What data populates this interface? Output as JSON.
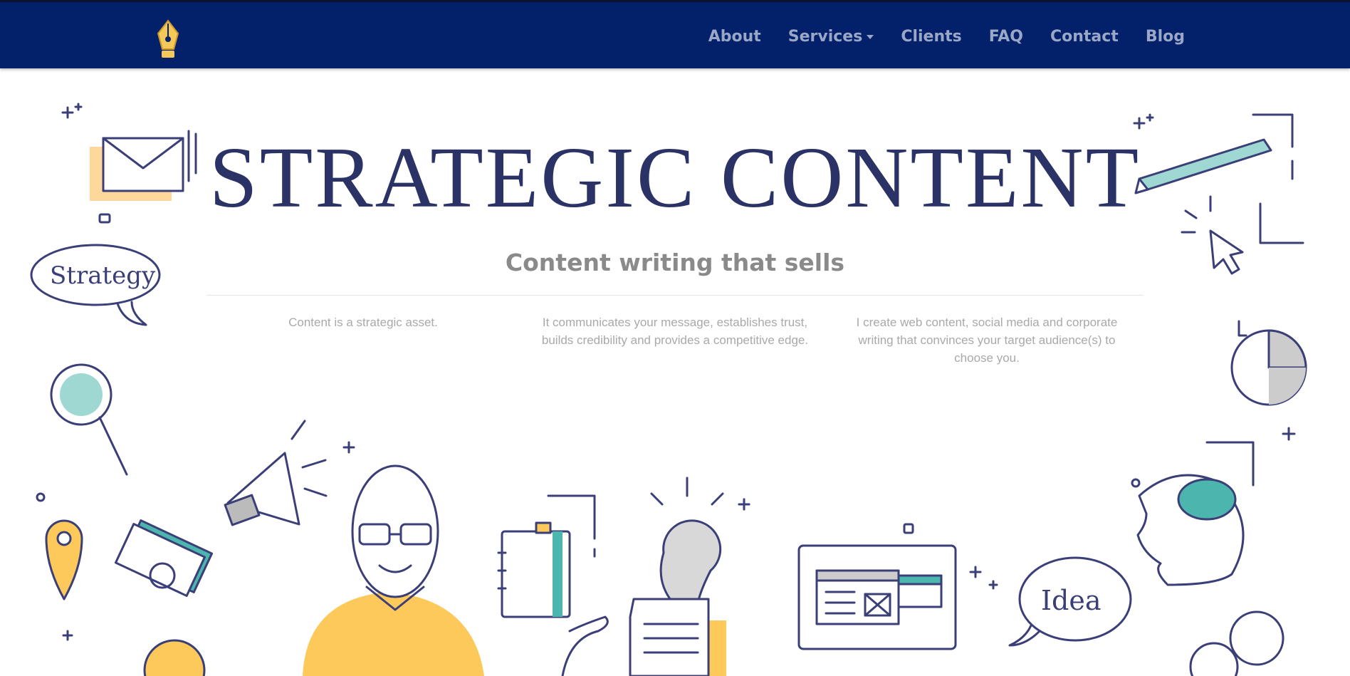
{
  "nav": {
    "items": [
      {
        "label": "About"
      },
      {
        "label": "Services",
        "dropdown": true
      },
      {
        "label": "Clients"
      },
      {
        "label": "FAQ"
      },
      {
        "label": "Contact"
      },
      {
        "label": "Blog"
      }
    ]
  },
  "hero": {
    "title": "STRATEGIC CONTENT",
    "subtitle": "Content writing that sells",
    "columns": [
      "Content is a strategic asset.",
      "It communicates your message, establishes trust, builds credibility and provides a competitive edge.",
      "I create web content, social media and corporate writing that convinces your target audience(s) to choose you."
    ]
  },
  "illustration": {
    "bubble_strategy": "Strategy",
    "bubble_idea": "Idea"
  },
  "colors": {
    "nav_bg": "#03206b",
    "nav_text": "#9aa7c6",
    "title": "#2b3266",
    "accent_yellow": "#fdc95a",
    "accent_teal": "#4bb5ae",
    "line": "#3b3f78"
  }
}
